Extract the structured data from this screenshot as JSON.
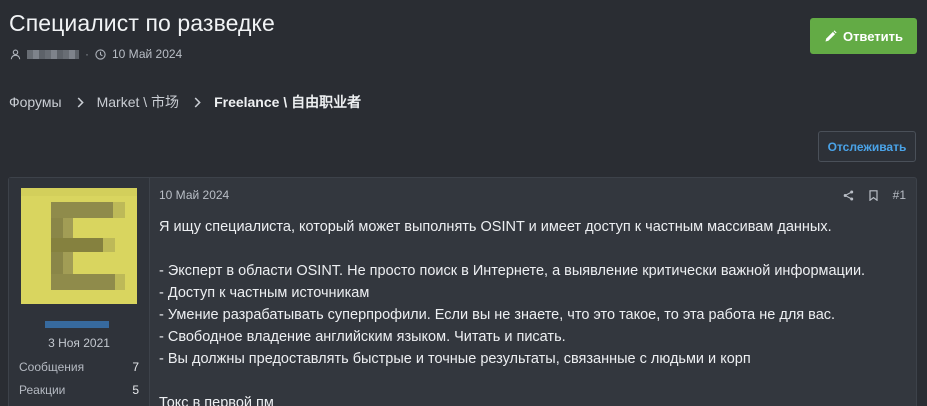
{
  "thread": {
    "title": "Специалист по разведке",
    "date": "10 Май 2024",
    "meta_separator": "·"
  },
  "buttons": {
    "reply_label": "Ответить",
    "follow_label": "Отслеживать"
  },
  "breadcrumb": {
    "items": [
      "Форумы",
      "Market \\ 市场",
      "Freelance \\ 自由职业者"
    ]
  },
  "post": {
    "date": "10 Май 2024",
    "number": "#1",
    "author": {
      "avatar_letter": "E",
      "join_date": "3 Ноя 2021",
      "stats": [
        {
          "label": "Сообщения",
          "value": "7"
        },
        {
          "label": "Реакции",
          "value": "5"
        }
      ]
    },
    "body": {
      "intro": "Я ищу специалиста, который может выполнять OSINT и имеет доступ к частным массивам данных.",
      "requirements": [
        "- Эксперт в области OSINT. Не просто поиск в Интернете, а выявление критически важной информации.",
        "- Доступ к частным источникам",
        "- Умение разрабатывать суперпрофили. Если вы не знаете, что это такое, то эта работа не для вас.",
        "- Свободное владение английским языком. Читать и писать.",
        "- Вы должны предоставлять быстрые и точные результаты, связанные с людьми и корп"
      ],
      "outro": "Токс в первой пм"
    }
  },
  "colors": {
    "background": "#2a2d33",
    "reply_green": "#63ab45",
    "follow_blue": "#4aa3e8",
    "avatar_yellow": "#d9d55f"
  },
  "icons": {
    "author": "user-icon",
    "date": "clock-icon",
    "reply": "pencil-icon",
    "share": "share-icon",
    "bookmark": "bookmark-icon",
    "breadcrumb": "chevron-right-icon"
  }
}
